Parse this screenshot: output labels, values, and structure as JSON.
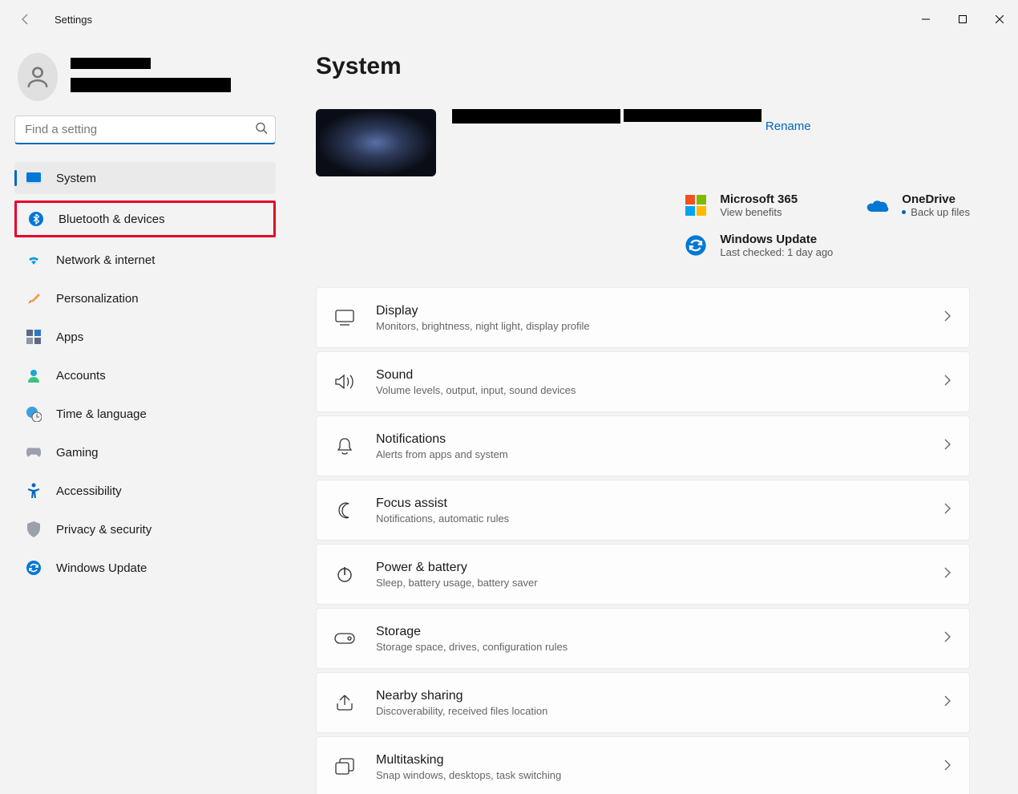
{
  "window": {
    "title": "Settings"
  },
  "search": {
    "placeholder": "Find a setting"
  },
  "nav": {
    "items": [
      {
        "id": "system",
        "label": "System"
      },
      {
        "id": "bluetooth",
        "label": "Bluetooth & devices"
      },
      {
        "id": "network",
        "label": "Network & internet"
      },
      {
        "id": "personalization",
        "label": "Personalization"
      },
      {
        "id": "apps",
        "label": "Apps"
      },
      {
        "id": "accounts",
        "label": "Accounts"
      },
      {
        "id": "time",
        "label": "Time & language"
      },
      {
        "id": "gaming",
        "label": "Gaming"
      },
      {
        "id": "accessibility",
        "label": "Accessibility"
      },
      {
        "id": "privacy",
        "label": "Privacy & security"
      },
      {
        "id": "update",
        "label": "Windows Update"
      }
    ],
    "active": "system",
    "highlighted": "bluetooth"
  },
  "page": {
    "title": "System",
    "rename": "Rename",
    "tiles": {
      "m365": {
        "title": "Microsoft 365",
        "sub": "View benefits"
      },
      "onedrive": {
        "title": "OneDrive",
        "sub": "Back up files"
      },
      "update": {
        "title": "Windows Update",
        "sub": "Last checked: 1 day ago"
      }
    },
    "settings": [
      {
        "id": "display",
        "title": "Display",
        "desc": "Monitors, brightness, night light, display profile"
      },
      {
        "id": "sound",
        "title": "Sound",
        "desc": "Volume levels, output, input, sound devices"
      },
      {
        "id": "notifications",
        "title": "Notifications",
        "desc": "Alerts from apps and system"
      },
      {
        "id": "focus",
        "title": "Focus assist",
        "desc": "Notifications, automatic rules"
      },
      {
        "id": "power",
        "title": "Power & battery",
        "desc": "Sleep, battery usage, battery saver"
      },
      {
        "id": "storage",
        "title": "Storage",
        "desc": "Storage space, drives, configuration rules"
      },
      {
        "id": "nearby",
        "title": "Nearby sharing",
        "desc": "Discoverability, received files location"
      },
      {
        "id": "multi",
        "title": "Multitasking",
        "desc": "Snap windows, desktops, task switching"
      }
    ]
  }
}
